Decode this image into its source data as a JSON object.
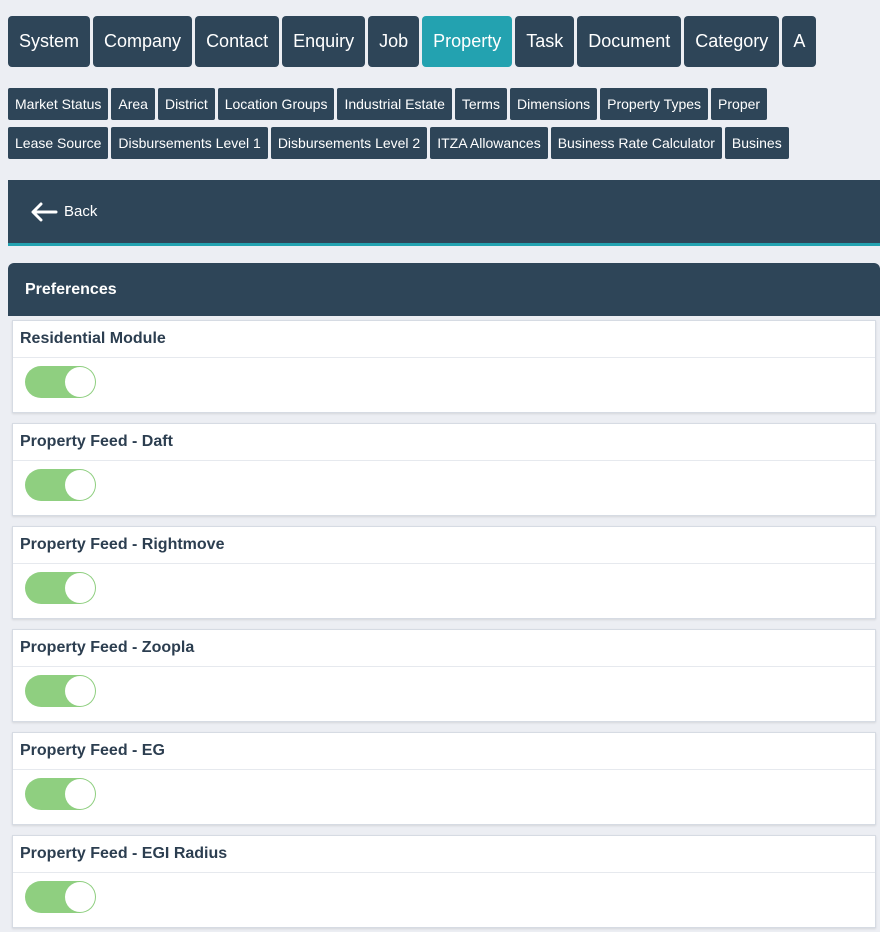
{
  "main_nav": {
    "tabs": [
      {
        "label": "System",
        "active": false
      },
      {
        "label": "Company",
        "active": false
      },
      {
        "label": "Contact",
        "active": false
      },
      {
        "label": "Enquiry",
        "active": false
      },
      {
        "label": "Job",
        "active": false
      },
      {
        "label": "Property",
        "active": true
      },
      {
        "label": "Task",
        "active": false
      },
      {
        "label": "Document",
        "active": false
      },
      {
        "label": "Category",
        "active": false
      },
      {
        "label": "A",
        "active": false
      }
    ]
  },
  "sub_nav": {
    "row1": [
      "Market Status",
      "Area",
      "District",
      "Location Groups",
      "Industrial Estate",
      "Terms",
      "Dimensions",
      "Property Types",
      "Proper"
    ],
    "row2": [
      "Lease Source",
      "Disbursements Level 1",
      "Disbursements Level 2",
      "ITZA Allowances",
      "Business Rate Calculator",
      "Busines"
    ]
  },
  "back": {
    "label": "Back",
    "icon": "arrow-left-icon"
  },
  "preferences": {
    "title": "Preferences",
    "items": [
      {
        "label": "Residential Module",
        "enabled": true
      },
      {
        "label": "Property Feed - Daft",
        "enabled": true
      },
      {
        "label": "Property Feed - Rightmove",
        "enabled": true
      },
      {
        "label": "Property Feed - Zoopla",
        "enabled": true
      },
      {
        "label": "Property Feed - EG",
        "enabled": true
      },
      {
        "label": "Property Feed - EGI Radius",
        "enabled": true
      }
    ]
  },
  "colors": {
    "nav_bg": "#2e4558",
    "accent": "#23a2b0",
    "toggle_on": "#8fcf80",
    "page_bg": "#eceef3"
  }
}
